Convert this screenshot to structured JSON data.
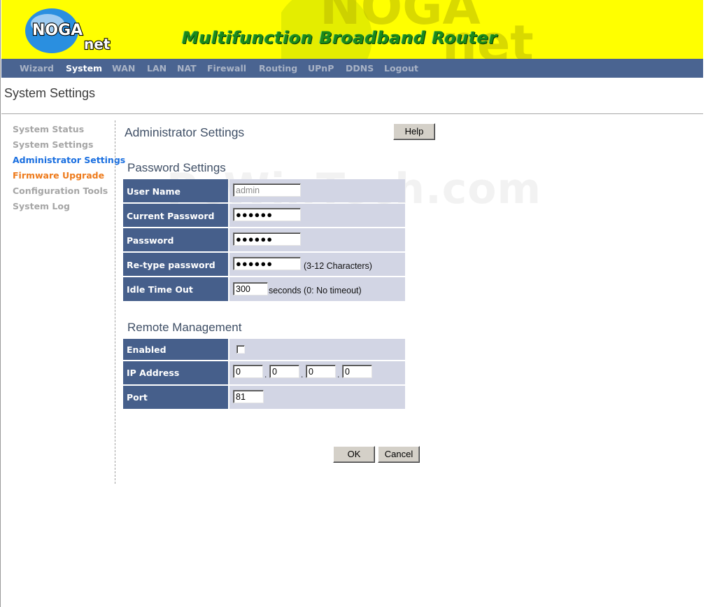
{
  "header": {
    "logo_text_top": "NOGA",
    "logo_text_bottom": "net",
    "banner_title": "Multifunction Broadband Router"
  },
  "topnav": {
    "items": [
      {
        "label": "Wizard",
        "active": false
      },
      {
        "label": "System",
        "active": true
      },
      {
        "label": "WAN",
        "active": false
      },
      {
        "label": "LAN",
        "active": false
      },
      {
        "label": "NAT",
        "active": false
      },
      {
        "label": "Firewall",
        "active": false
      },
      {
        "label": "Routing",
        "active": false
      },
      {
        "label": "UPnP",
        "active": false
      },
      {
        "label": "DDNS",
        "active": false
      },
      {
        "label": "Logout",
        "active": false
      }
    ]
  },
  "page_title": "System Settings",
  "sidebar": {
    "items": [
      {
        "label": "System Status"
      },
      {
        "label": "System Settings"
      },
      {
        "label": "Administrator Settings",
        "state": "active"
      },
      {
        "label": "Firmware Upgrade",
        "state": "highlight"
      },
      {
        "label": "Configuration Tools"
      },
      {
        "label": "System Log"
      }
    ]
  },
  "main": {
    "heading": "Administrator Settings",
    "help_label": "Help",
    "password_section": {
      "heading": "Password Settings",
      "user_name": {
        "label": "User Name",
        "value": "admin"
      },
      "current_password": {
        "label": "Current Password",
        "value": "●●●●●●"
      },
      "password": {
        "label": "Password",
        "value": "●●●●●●"
      },
      "retype_password": {
        "label": "Re-type password",
        "value": "●●●●●●",
        "hint": "(3-12 Characters)"
      },
      "idle_timeout": {
        "label": "Idle Time Out",
        "value": "300",
        "hint": "seconds (0: No timeout)"
      }
    },
    "remote_section": {
      "heading": "Remote Management",
      "enabled": {
        "label": "Enabled",
        "checked": false
      },
      "ip_address": {
        "label": "IP Address",
        "octets": [
          "0",
          "0",
          "0",
          "0"
        ],
        "separator": "."
      },
      "port": {
        "label": "Port",
        "value": "81"
      }
    },
    "ok_label": "OK",
    "cancel_label": "Cancel"
  },
  "watermark": "PcWinTech.com",
  "colors": {
    "banner_yellow": "#ffff00",
    "nav_blue": "#4a6491",
    "label_bg": "#465f8b",
    "value_bg": "#d2d5e4",
    "sidebar_active": "#1a6fe0",
    "sidebar_highlight": "#ee7b1c"
  }
}
